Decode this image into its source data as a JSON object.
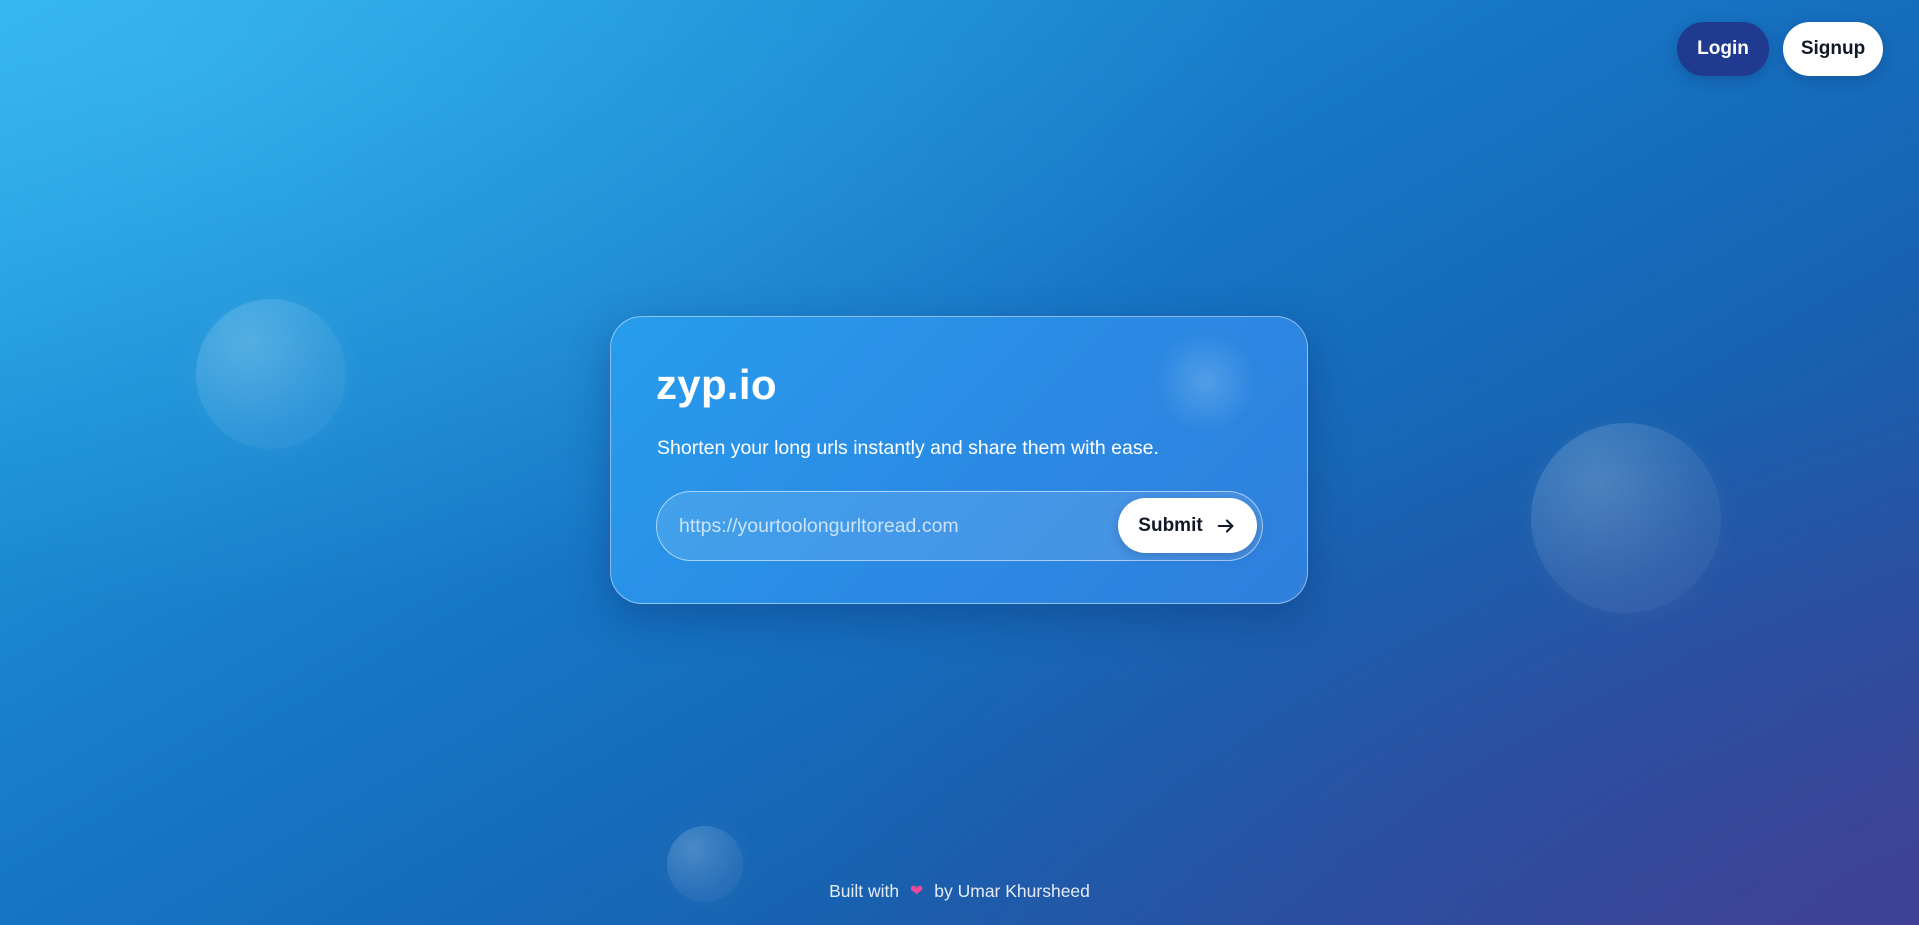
{
  "nav": {
    "login_label": "Login",
    "signup_label": "Signup"
  },
  "card": {
    "title": "zyp.io",
    "subtitle": "Shorten your long urls instantly and share them with ease.",
    "url_input": {
      "placeholder": "https://yourtoolongurltoread.com",
      "value": ""
    },
    "submit_label": "Submit",
    "submit_icon": "arrow-right-icon"
  },
  "footer": {
    "prefix": "Built with",
    "icon": "heart-icon",
    "suffix": "by Umar Khursheed"
  },
  "colors": {
    "background_start": "#2bb0ec",
    "background_end": "#3a4595",
    "login_button": "#1f3a8f",
    "signup_button": "#ffffff",
    "card": "#2b8ae4",
    "heart": "#ec4899"
  }
}
